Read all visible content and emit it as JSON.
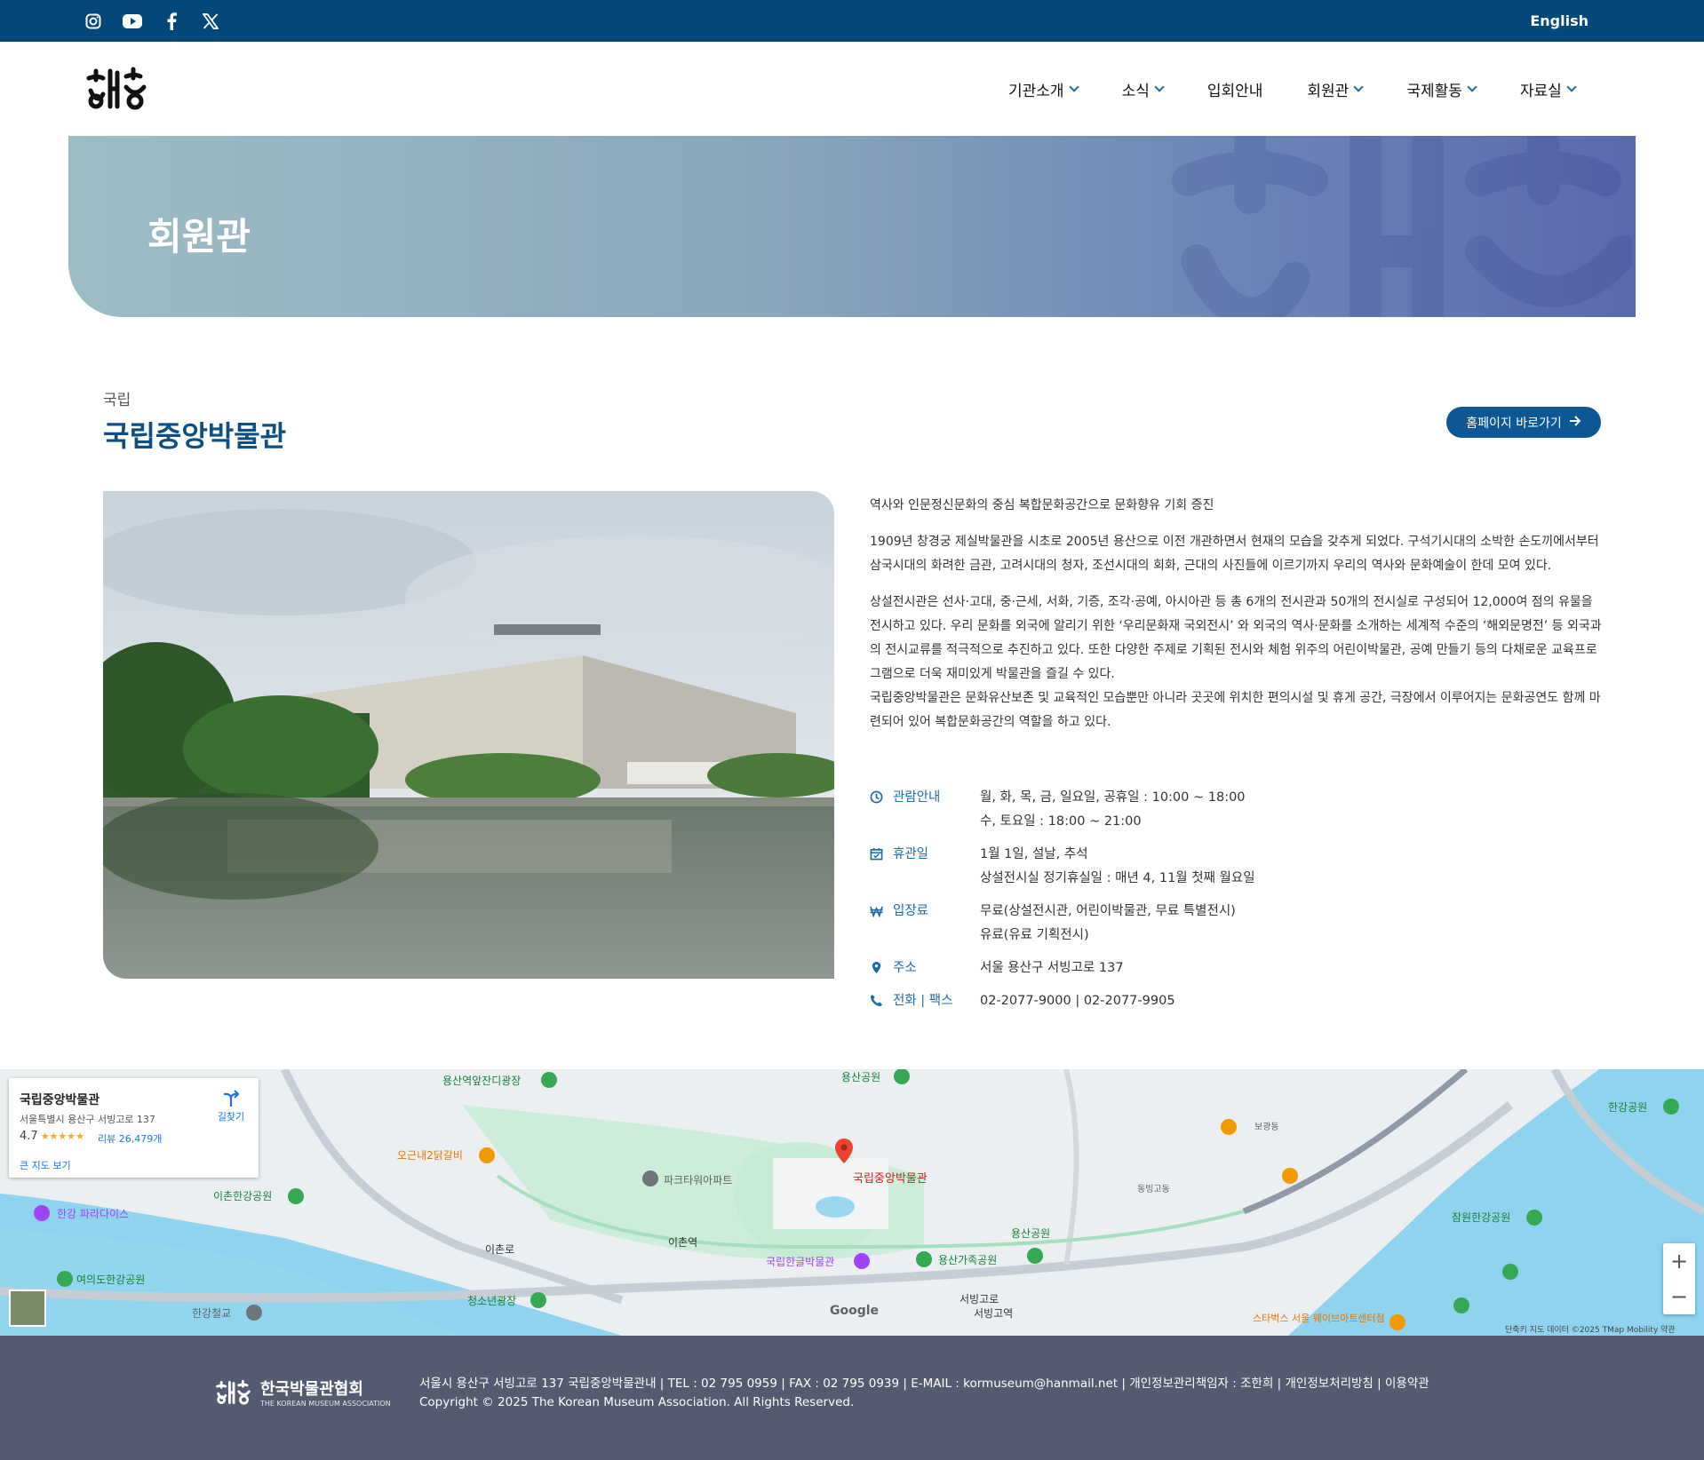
{
  "topbar": {
    "lang": "English",
    "icons": [
      "instagram-icon",
      "youtube-icon",
      "facebook-icon",
      "x-icon"
    ]
  },
  "nav": [
    {
      "label": "기관소개",
      "dropdown": true
    },
    {
      "label": "소식",
      "dropdown": true
    },
    {
      "label": "입회안내",
      "dropdown": false
    },
    {
      "label": "회원관",
      "dropdown": true
    },
    {
      "label": "국제활동",
      "dropdown": true
    },
    {
      "label": "자료실",
      "dropdown": true
    }
  ],
  "hero": {
    "title": "회원관"
  },
  "museum": {
    "category": "국립",
    "name": "국립중앙박물관",
    "homepage_label": "홈페이지 바로가기",
    "desc_1": "역사와 인문정신문화의 중심 복합문화공간으로 문화향유 기회 증진",
    "desc_2": "1909년 창경궁 제실박물관을 시초로 2005년 용산으로 이전 개관하면서 현재의 모습을 갖추게 되었다. 구석기시대의 소박한 손도끼에서부터 삼국시대의 화려한 금관, 고려시대의 청자, 조선시대의 회화, 근대의 사진들에 이르기까지 우리의 역사와 문화예술이 한데 모여 있다.",
    "desc_3": "상설전시관은 선사·고대, 중·근세, 서화, 기증, 조각·공예, 아시아관 등 총 6개의 전시관과 50개의 전시실로 구성되어 12,000여 점의 유물을 전시하고 있다. 우리 문화를 외국에 알리기 위한 ‘우리문화재 국외전시’ 와 외국의 역사·문화를 소개하는 세계적 수준의 ‘해외문명전’ 등 외국과의 전시교류를 적극적으로 추진하고 있다. 또한 다양한 주제로 기획된 전시와 체험 위주의 어린이박물관, 공예 만들기 등의 다채로운 교육프로그램으로 더욱 재미있게 박물관을 즐길 수 있다.",
    "desc_4": "국립중앙박물관은 문화유산보존 및 교육적인 모습뿐만 아니라 곳곳에 위치한 편의시설 및 휴게 공간, 극장에서 이루어지는 문화공연도 함께 마련되어 있어 복합문화공간의 역할을 하고 있다.",
    "info": {
      "hours_label": "관람안내",
      "hours_1": "월, 화, 목, 금, 일요일, 공휴일 : 10:00 ~ 18:00",
      "hours_2": "수, 토요일 : 18:00 ~ 21:00",
      "closed_label": "휴관일",
      "closed_1": "1월 1일, 설날, 추석",
      "closed_2": "상설전시실 정기휴실일 : 매년 4, 11월 첫째 월요일",
      "fee_label": "입장료",
      "fee_1": "무료(상설전시관, 어린이박물관, 무료 특별전시)",
      "fee_2": "유료(유료 기획전시)",
      "addr_label": "주소",
      "addr": "서울 용산구 서빙고로 137",
      "tel_label": "전화 | 팩스",
      "tel": "02-2077-9000 | 02-2077-9905"
    }
  },
  "map": {
    "card_name": "국립중앙박물관",
    "card_addr": "서울특별시 용산구 서빙고로 137",
    "rating": "4.7",
    "stars": "★★★★★",
    "reviews": "리뷰 26,479개",
    "directions": "길찾기",
    "big_map": "큰 지도 보기",
    "pin_label": "국립중앙박물관",
    "labels": [
      "용산역앞잔디광장",
      "용산공원",
      "오근내2닭갈비",
      "파크타워아파트",
      "이촌한강공원",
      "한강 파라다이스",
      "이촌역",
      "국립한글박물관",
      "용산가족공원",
      "여의도한강공원",
      "청소년광장",
      "한강철교",
      "잠원한강공원",
      "한강공원",
      "스타벅스 서울 웨이브아트센터점",
      "서빙고로",
      "이촌로",
      "동빙고동",
      "보광동",
      "용산공원",
      "서빙고역"
    ],
    "attribution": "단축키  지도 데이터 ©2025 TMap Mobility  약관",
    "zoom_in": "+",
    "zoom_out": "−"
  },
  "footer": {
    "org": "한국박물관협회",
    "org_en": "THE KOREAN MUSEUM ASSOCIATION",
    "line1": "서울시 용산구 서빙고로 137 국립중앙박물관내 | TEL : 02 795 0959 | FAX : 02 795 0939 | E-MAIL : kormuseum@hanmail.net | 개인정보관리책임자 : 조한희 | 개인정보처리방침 | 이용약관",
    "line2": "Copyright © 2025 The Korean Museum Association. All Rights Reserved."
  }
}
